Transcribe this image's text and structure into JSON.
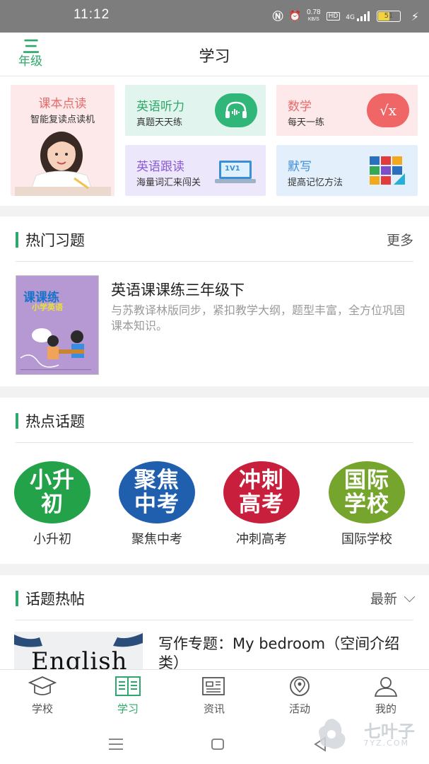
{
  "status_bar": {
    "time": "11:12",
    "net_speed": "0.78",
    "net_unit": "KB/S",
    "hd": "HD",
    "network": "4G",
    "battery": "51"
  },
  "header": {
    "grade_icon_text": "三",
    "grade_label": "年级",
    "title": "学习"
  },
  "feature_cards": [
    {
      "title": "课本点读",
      "subtitle": "智能复读点读机"
    },
    {
      "title": "英语听力",
      "subtitle": "真题天天练"
    },
    {
      "title": "数学",
      "subtitle": "每天一练",
      "icon_text": "√x"
    },
    {
      "title": "英语跟读",
      "subtitle": "海量词汇来闯关",
      "icon_text": "1V1"
    },
    {
      "title": "默写",
      "subtitle": "提高记忆方法"
    }
  ],
  "hot_exercises": {
    "heading": "热门习题",
    "more": "更多",
    "book": {
      "title": "英语课课练三年级下",
      "description": "与苏教译林版同步，紧扣教学大纲，题型丰富，全方位巩固课本知识。",
      "cover_title": "课课练",
      "cover_subtitle": "小学英语"
    }
  },
  "hot_topics": {
    "heading": "热点话题",
    "items": [
      {
        "line1": "小升",
        "line2": "初",
        "label": "小升初",
        "color": "#23a24a"
      },
      {
        "line1": "聚焦",
        "line2": "中考",
        "label": "聚焦中考",
        "color": "#1f5fae"
      },
      {
        "line1": "冲刺",
        "line2": "高考",
        "label": "冲刺高考",
        "color": "#c8203c"
      },
      {
        "line1": "国际",
        "line2": "学校",
        "label": "国际学校",
        "color": "#76a52d"
      }
    ]
  },
  "topic_posts": {
    "heading": "话题热帖",
    "sort": "最新",
    "post": {
      "title": "写作专题：My bedroom（空间介绍类）",
      "image_text": "English"
    }
  },
  "tabs": [
    {
      "label": "学校",
      "icon": "mortarboard-icon"
    },
    {
      "label": "学习",
      "icon": "open-book-icon"
    },
    {
      "label": "资讯",
      "icon": "newspaper-icon"
    },
    {
      "label": "活动",
      "icon": "location-pin-icon"
    },
    {
      "label": "我的",
      "icon": "person-icon"
    }
  ],
  "watermark": {
    "name": "七叶子",
    "url": "7YZ.COM"
  },
  "colors": {
    "accent": "#2ea86a",
    "status_bar": "#7d7d7d"
  }
}
